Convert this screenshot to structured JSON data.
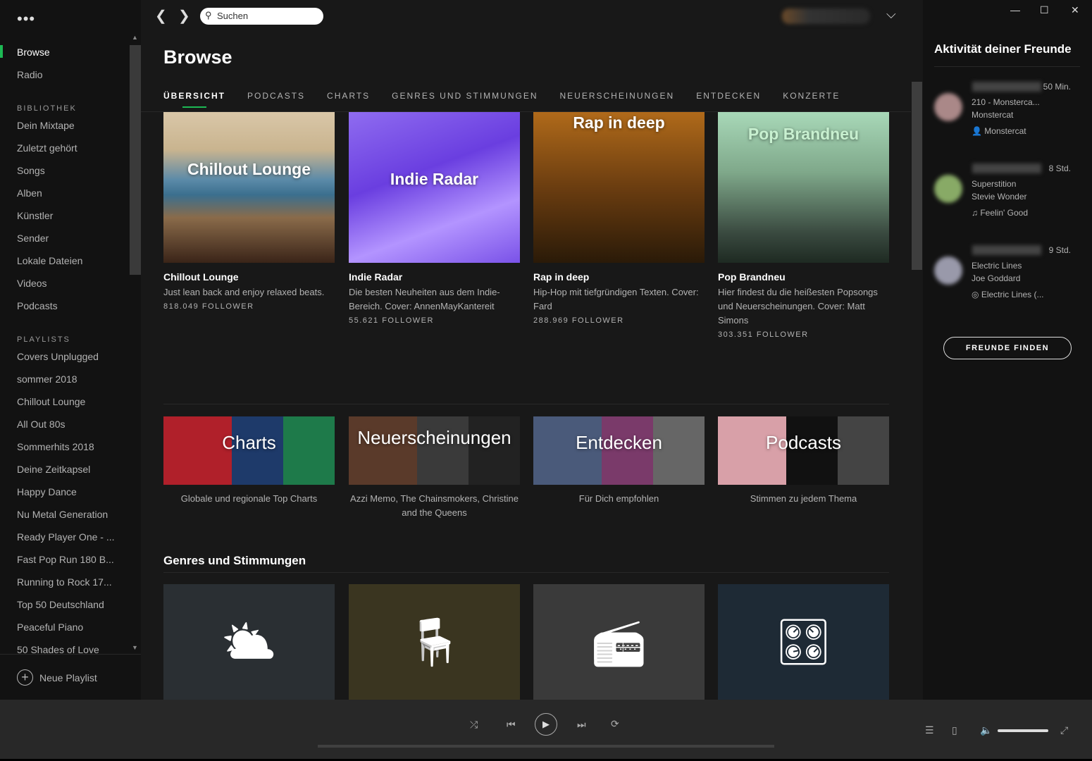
{
  "sidebar": {
    "menu": "•••",
    "nav": [
      "Browse",
      "Radio"
    ],
    "library_heading": "BIBLIOTHEK",
    "library": [
      "Dein Mixtape",
      "Zuletzt gehört",
      "Songs",
      "Alben",
      "Künstler",
      "Sender",
      "Lokale Dateien",
      "Videos",
      "Podcasts"
    ],
    "playlists_heading": "PLAYLISTS",
    "playlists": [
      "Covers Unplugged",
      "sommer 2018",
      "Chillout Lounge",
      "All Out 80s",
      "Sommerhits 2018",
      "Deine Zeitkapsel",
      "Happy Dance",
      "Nu Metal Generation",
      "Ready Player One - ...",
      "Fast Pop Run 180 B...",
      "Running to Rock 17...",
      "Top 50 Deutschland",
      "Peaceful Piano",
      "50 Shades of Love"
    ],
    "new_playlist": "Neue Playlist"
  },
  "topbar": {
    "search_placeholder": "Suchen"
  },
  "main": {
    "title": "Browse",
    "tabs": [
      "ÜBERSICHT",
      "PODCASTS",
      "CHARTS",
      "GENRES UND STIMMUNGEN",
      "NEUERSCHEINUNGEN",
      "ENTDECKEN",
      "KONZERTE"
    ],
    "playlists": [
      {
        "overlay": "Chillout Lounge",
        "name": "Chillout Lounge",
        "desc": "Just lean back and enjoy relaxed beats.",
        "followers": "818.049 FOLLOWER"
      },
      {
        "overlay": "Indie Radar",
        "name": "Indie Radar",
        "desc": "Die besten Neuheiten aus dem Indie-Bereich. Cover: AnnenMayKantereit",
        "followers": "55.621 FOLLOWER"
      },
      {
        "overlay": "Rap in deep",
        "name": "Rap in deep",
        "desc": "Hip-Hop mit tiefgründigen Texten. Cover: Fard",
        "followers": "288.969 FOLLOWER"
      },
      {
        "overlay": "Pop Brandneu",
        "name": "Pop Brandneu",
        "desc": "Hier findest du die heißesten Popsongs und Neuerscheinungen. Cover: Matt Simons",
        "followers": "303.351 FOLLOWER"
      }
    ],
    "categories": [
      {
        "overlay": "Charts",
        "desc": "Globale und regionale Top Charts"
      },
      {
        "overlay": "Neuerscheinungen",
        "desc": "Azzi Memo, The Chainsmokers, Christine and the Queens"
      },
      {
        "overlay": "Entdecken",
        "desc": "Für Dich empfohlen"
      },
      {
        "overlay": "Podcasts",
        "desc": "Stimmen zu jedem Thema"
      }
    ],
    "genres_heading": "Genres und Stimmungen",
    "genres": [
      {
        "icon": "weather-icon",
        "glyph": "⛅"
      },
      {
        "icon": "chair-icon",
        "glyph": "🪑"
      },
      {
        "icon": "boombox-icon",
        "glyph": "📻"
      },
      {
        "icon": "turntable-icon",
        "glyph": "🎛"
      }
    ]
  },
  "friends": {
    "title": "Aktivität deiner Freunde",
    "items": [
      {
        "time": "50 Min.",
        "track": "210 - Monsterca...",
        "artist": "Monstercat",
        "context": "Monstercat",
        "context_icon": "artist-icon",
        "avatar": "#a88"
      },
      {
        "time": "8 Std.",
        "track": "Superstition",
        "artist": "Stevie Wonder",
        "context": "Feelin' Good",
        "context_icon": "playlist-icon",
        "avatar": "#8a6"
      },
      {
        "time": "9 Std.",
        "track": "Electric Lines",
        "artist": "Joe Goddard",
        "context": "Electric Lines (...",
        "context_icon": "album-icon",
        "avatar": "#99a"
      }
    ],
    "find_button": "FREUNDE FINDEN"
  },
  "player": {
    "volume": 0.95,
    "progress": 0
  }
}
